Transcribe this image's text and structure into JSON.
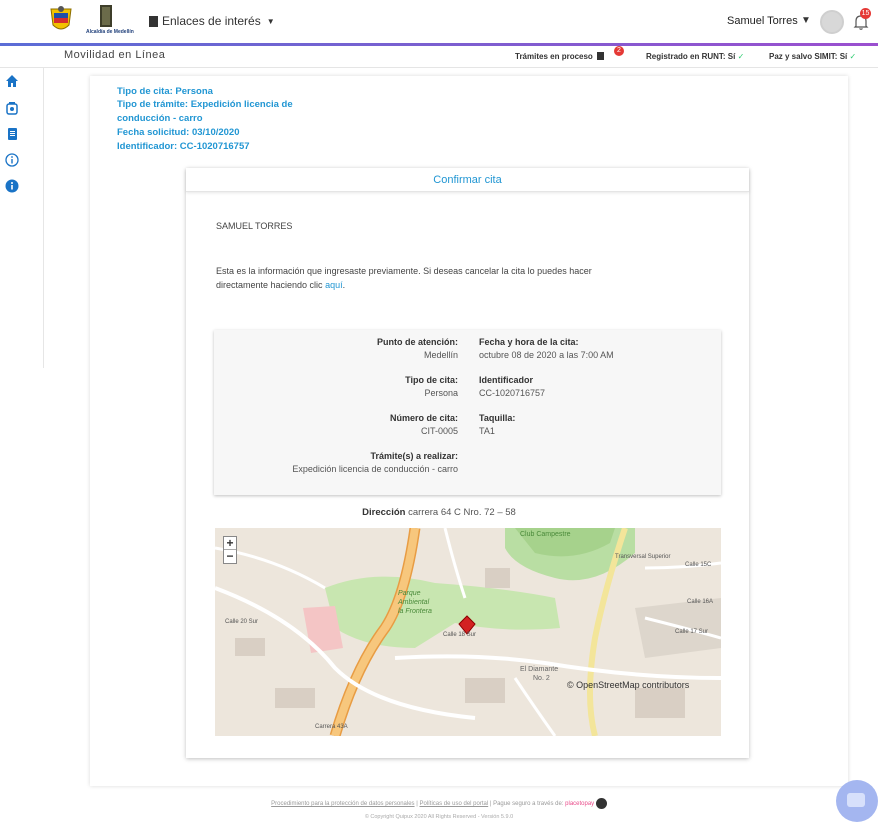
{
  "header": {
    "links_label": "Enlaces de interés",
    "logo_caption": "Alcaldía de Medellín",
    "user_name": "Samuel Torres",
    "notification_count": "15"
  },
  "subheader": {
    "app_title": "Movilidad en Línea",
    "tramites": "Trámites en proceso",
    "tramites_count": "2",
    "runt": "Registrado en RUNT: Sí",
    "simit": "Paz y salvo SIMIT: Sí",
    "check": "✓"
  },
  "info": {
    "tipo_cita": "Tipo de cita: Persona",
    "tipo_tramite_1": "Tipo de trámite: Expedición licencia de",
    "tipo_tramite_2": "conducción - carro",
    "fecha": "Fecha solicitud: 03/10/2020",
    "identificador": "Identificador: CC-1020716757"
  },
  "confirm": {
    "title": "Confirmar cita",
    "name": "SAMUEL TORRES",
    "desc_1": "Esta es la información que ingresaste previamente. Si deseas cancelar la cita lo puedes hacer",
    "desc_2": "directamente haciendo clic",
    "link": "aquí",
    "punto_label": "Punto de atención:",
    "punto_value": "Medellín",
    "fecha_label": "Fecha y hora de la cita:",
    "fecha_value": "octubre 08 de 2020 a las 7:00 AM",
    "tipo_label": "Tipo de cita:",
    "tipo_value": "Persona",
    "ident_label": "Identificador",
    "ident_value": "CC-1020716757",
    "numero_label": "Número de cita:",
    "numero_value": "CIT-0005",
    "taquilla_label": "Taquilla:",
    "taquilla_value": "TA1",
    "tramite_label": "Trámite(s) a realizar:",
    "tramite_value": "Expedición licencia de conducción - carro",
    "direccion_label": "Dirección",
    "direccion_value": "carrera 64 C Nro. 72 – 58"
  },
  "map": {
    "zoom_in": "+",
    "zoom_out": "−",
    "attribution": "© OpenStreetMap contributors",
    "labels": {
      "club": "Club Campestre",
      "parque1": "Parque",
      "parque2": "Ambiental",
      "parque3": "la Frontera",
      "calle18": "Calle 18 Sur",
      "diamante1": "El Diamante",
      "diamante2": "No. 2",
      "calle15c": "Calle 15C",
      "calle16": "Calle 16A",
      "calle17": "Calle 17 Sur",
      "transversal": "Transversal Superior",
      "carrera43a": "Carrera 43A",
      "calle20": "Calle 20 Sur"
    }
  },
  "footer": {
    "link1": "Procedimiento para la protección de datos personales",
    "sep": "|",
    "link2": "Políticas de uso del portal",
    "pay": "Pague seguro a través de:",
    "pay_brand": "placetopay",
    "copyright": "© Copyright Quipux 2020 All Rights Reserved - Versión 5.9.0"
  }
}
